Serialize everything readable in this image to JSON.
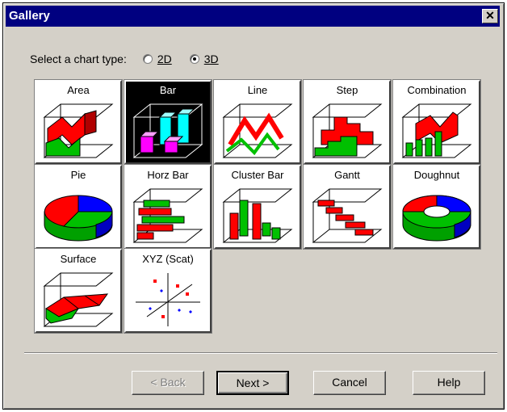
{
  "window": {
    "title": "Gallery",
    "close_glyph": "✕"
  },
  "selector": {
    "label": "Select a chart type:",
    "options": [
      {
        "label": "2D",
        "selected": false
      },
      {
        "label": "3D",
        "selected": true
      }
    ]
  },
  "gallery": {
    "selected": "Bar",
    "tiles": [
      {
        "label": "Area",
        "icon": "area-chart-icon"
      },
      {
        "label": "Bar",
        "icon": "bar-chart-icon"
      },
      {
        "label": "Line",
        "icon": "line-chart-icon"
      },
      {
        "label": "Step",
        "icon": "step-chart-icon"
      },
      {
        "label": "Combination",
        "icon": "combination-chart-icon"
      },
      {
        "label": "Pie",
        "icon": "pie-chart-icon"
      },
      {
        "label": "Horz Bar",
        "icon": "horizontal-bar-chart-icon"
      },
      {
        "label": "Cluster Bar",
        "icon": "cluster-bar-chart-icon"
      },
      {
        "label": "Gantt",
        "icon": "gantt-chart-icon"
      },
      {
        "label": "Doughnut",
        "icon": "doughnut-chart-icon"
      },
      {
        "label": "Surface",
        "icon": "surface-chart-icon"
      },
      {
        "label": "XYZ (Scat)",
        "icon": "scatter-chart-icon"
      }
    ]
  },
  "buttons": {
    "back": "< Back",
    "next": "Next >",
    "cancel": "Cancel",
    "help": "Help"
  },
  "colors": {
    "title_bar": "#000080",
    "face": "#d4d0c8",
    "red": "#ff0000",
    "green": "#00c000",
    "blue": "#0000ff",
    "cyan": "#00ffff",
    "magenta": "#ff00ff"
  }
}
